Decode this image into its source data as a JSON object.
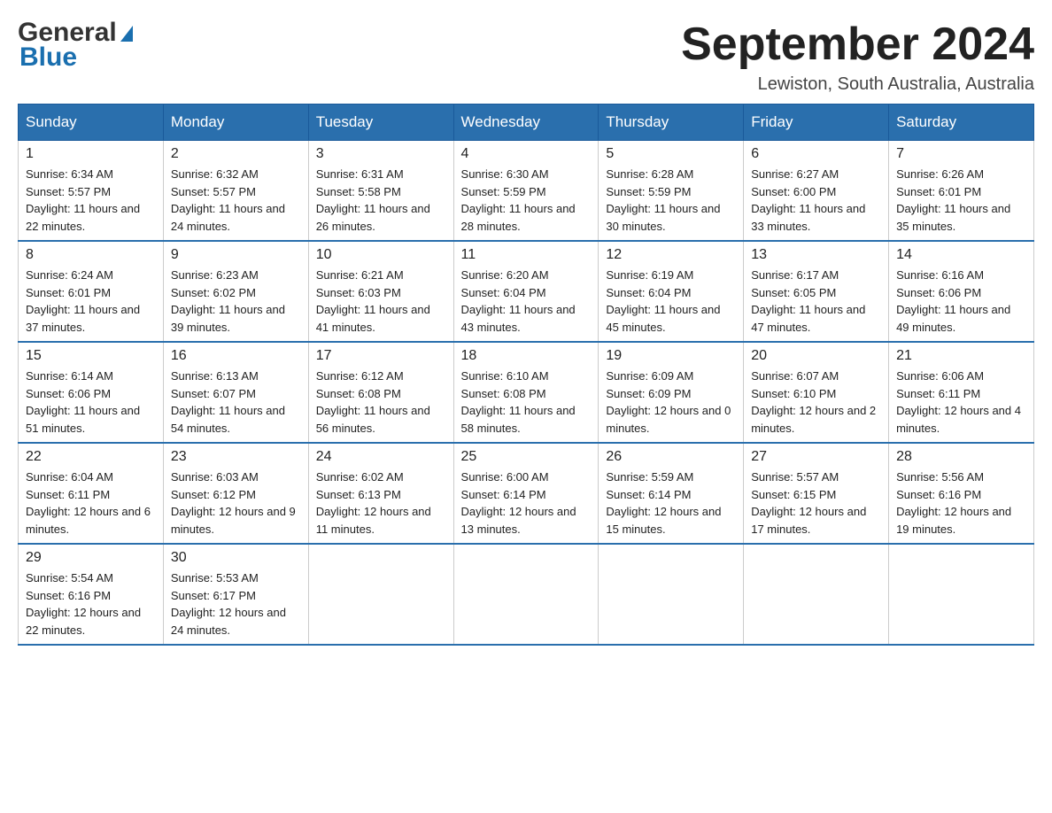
{
  "header": {
    "logo_line1": "General",
    "logo_line2": "Blue",
    "main_title": "September 2024",
    "subtitle": "Lewiston, South Australia, Australia"
  },
  "days_of_week": [
    "Sunday",
    "Monday",
    "Tuesday",
    "Wednesday",
    "Thursday",
    "Friday",
    "Saturday"
  ],
  "weeks": [
    [
      {
        "day": "1",
        "sunrise": "6:34 AM",
        "sunset": "5:57 PM",
        "daylight": "11 hours and 22 minutes."
      },
      {
        "day": "2",
        "sunrise": "6:32 AM",
        "sunset": "5:57 PM",
        "daylight": "11 hours and 24 minutes."
      },
      {
        "day": "3",
        "sunrise": "6:31 AM",
        "sunset": "5:58 PM",
        "daylight": "11 hours and 26 minutes."
      },
      {
        "day": "4",
        "sunrise": "6:30 AM",
        "sunset": "5:59 PM",
        "daylight": "11 hours and 28 minutes."
      },
      {
        "day": "5",
        "sunrise": "6:28 AM",
        "sunset": "5:59 PM",
        "daylight": "11 hours and 30 minutes."
      },
      {
        "day": "6",
        "sunrise": "6:27 AM",
        "sunset": "6:00 PM",
        "daylight": "11 hours and 33 minutes."
      },
      {
        "day": "7",
        "sunrise": "6:26 AM",
        "sunset": "6:01 PM",
        "daylight": "11 hours and 35 minutes."
      }
    ],
    [
      {
        "day": "8",
        "sunrise": "6:24 AM",
        "sunset": "6:01 PM",
        "daylight": "11 hours and 37 minutes."
      },
      {
        "day": "9",
        "sunrise": "6:23 AM",
        "sunset": "6:02 PM",
        "daylight": "11 hours and 39 minutes."
      },
      {
        "day": "10",
        "sunrise": "6:21 AM",
        "sunset": "6:03 PM",
        "daylight": "11 hours and 41 minutes."
      },
      {
        "day": "11",
        "sunrise": "6:20 AM",
        "sunset": "6:04 PM",
        "daylight": "11 hours and 43 minutes."
      },
      {
        "day": "12",
        "sunrise": "6:19 AM",
        "sunset": "6:04 PM",
        "daylight": "11 hours and 45 minutes."
      },
      {
        "day": "13",
        "sunrise": "6:17 AM",
        "sunset": "6:05 PM",
        "daylight": "11 hours and 47 minutes."
      },
      {
        "day": "14",
        "sunrise": "6:16 AM",
        "sunset": "6:06 PM",
        "daylight": "11 hours and 49 minutes."
      }
    ],
    [
      {
        "day": "15",
        "sunrise": "6:14 AM",
        "sunset": "6:06 PM",
        "daylight": "11 hours and 51 minutes."
      },
      {
        "day": "16",
        "sunrise": "6:13 AM",
        "sunset": "6:07 PM",
        "daylight": "11 hours and 54 minutes."
      },
      {
        "day": "17",
        "sunrise": "6:12 AM",
        "sunset": "6:08 PM",
        "daylight": "11 hours and 56 minutes."
      },
      {
        "day": "18",
        "sunrise": "6:10 AM",
        "sunset": "6:08 PM",
        "daylight": "11 hours and 58 minutes."
      },
      {
        "day": "19",
        "sunrise": "6:09 AM",
        "sunset": "6:09 PM",
        "daylight": "12 hours and 0 minutes."
      },
      {
        "day": "20",
        "sunrise": "6:07 AM",
        "sunset": "6:10 PM",
        "daylight": "12 hours and 2 minutes."
      },
      {
        "day": "21",
        "sunrise": "6:06 AM",
        "sunset": "6:11 PM",
        "daylight": "12 hours and 4 minutes."
      }
    ],
    [
      {
        "day": "22",
        "sunrise": "6:04 AM",
        "sunset": "6:11 PM",
        "daylight": "12 hours and 6 minutes."
      },
      {
        "day": "23",
        "sunrise": "6:03 AM",
        "sunset": "6:12 PM",
        "daylight": "12 hours and 9 minutes."
      },
      {
        "day": "24",
        "sunrise": "6:02 AM",
        "sunset": "6:13 PM",
        "daylight": "12 hours and 11 minutes."
      },
      {
        "day": "25",
        "sunrise": "6:00 AM",
        "sunset": "6:14 PM",
        "daylight": "12 hours and 13 minutes."
      },
      {
        "day": "26",
        "sunrise": "5:59 AM",
        "sunset": "6:14 PM",
        "daylight": "12 hours and 15 minutes."
      },
      {
        "day": "27",
        "sunrise": "5:57 AM",
        "sunset": "6:15 PM",
        "daylight": "12 hours and 17 minutes."
      },
      {
        "day": "28",
        "sunrise": "5:56 AM",
        "sunset": "6:16 PM",
        "daylight": "12 hours and 19 minutes."
      }
    ],
    [
      {
        "day": "29",
        "sunrise": "5:54 AM",
        "sunset": "6:16 PM",
        "daylight": "12 hours and 22 minutes."
      },
      {
        "day": "30",
        "sunrise": "5:53 AM",
        "sunset": "6:17 PM",
        "daylight": "12 hours and 24 minutes."
      },
      null,
      null,
      null,
      null,
      null
    ]
  ]
}
